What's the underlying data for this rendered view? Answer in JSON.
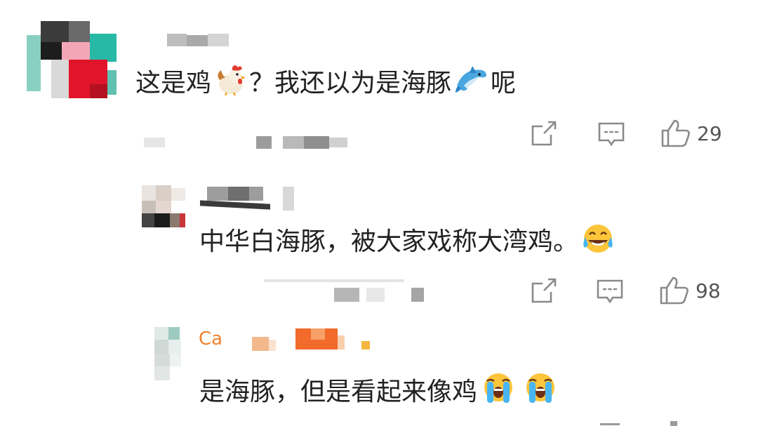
{
  "comments": [
    {
      "text_a": "这是鸡",
      "text_b": "？我还以为是海豚",
      "text_c": "呢",
      "emoji_1": "rooster-emoji",
      "emoji_2": "dolphin-emoji",
      "likes": "29",
      "actions": [
        "share-icon",
        "comment-icon",
        "like-icon"
      ]
    },
    {
      "text": "中华白海豚，被大家戏称大湾鸡。",
      "emoji": "tears-of-joy-emoji",
      "likes": "98",
      "actions": [
        "share-icon",
        "comment-icon",
        "like-icon"
      ]
    },
    {
      "username_partial": "Ca",
      "text": "是海豚，但是看起来像鸡",
      "emoji": "loudly-crying-emoji"
    }
  ],
  "colors": {
    "text": "#222222",
    "icon": "#8a8a8a",
    "username_orange": "#f0822f"
  }
}
